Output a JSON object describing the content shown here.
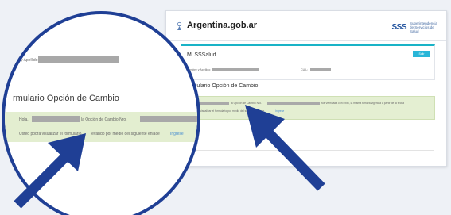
{
  "header": {
    "logo_text": "Argentina.gob.ar",
    "brand_mark": "SSS",
    "brand_tagline": "Superintendencia de Servicios de Salud"
  },
  "card": {
    "title": "Mi SSSalud",
    "button_label": "Salir",
    "name_label": "Nombre y Apellido:",
    "cuil_label": "CUIL:"
  },
  "form": {
    "title": "Formulario Opción de Cambio",
    "title_cropped": "rmulario Opción de Cambio",
    "line1_start": "Hola,",
    "line1_mid": "la Opción de Cambio Nro.",
    "line1_end": "fue verificada con éxito, la misma tomará vigencia a partir de la fecha",
    "line2": "Usted podrá visualizar el formulario por medio del siguiente enlace",
    "link_text": "Ingrese"
  },
  "lens": {
    "name_label_cropped": "y Apellido:",
    "line2_cropped": "Usted podrá visualizar el formulario",
    "line2_tail": "levando por medio del siguiente enlace",
    "link_text": "Ingrese"
  },
  "colors": {
    "arrow": "#1f3f95",
    "accent": "#19b3c7",
    "banner": "#e4efd2"
  }
}
